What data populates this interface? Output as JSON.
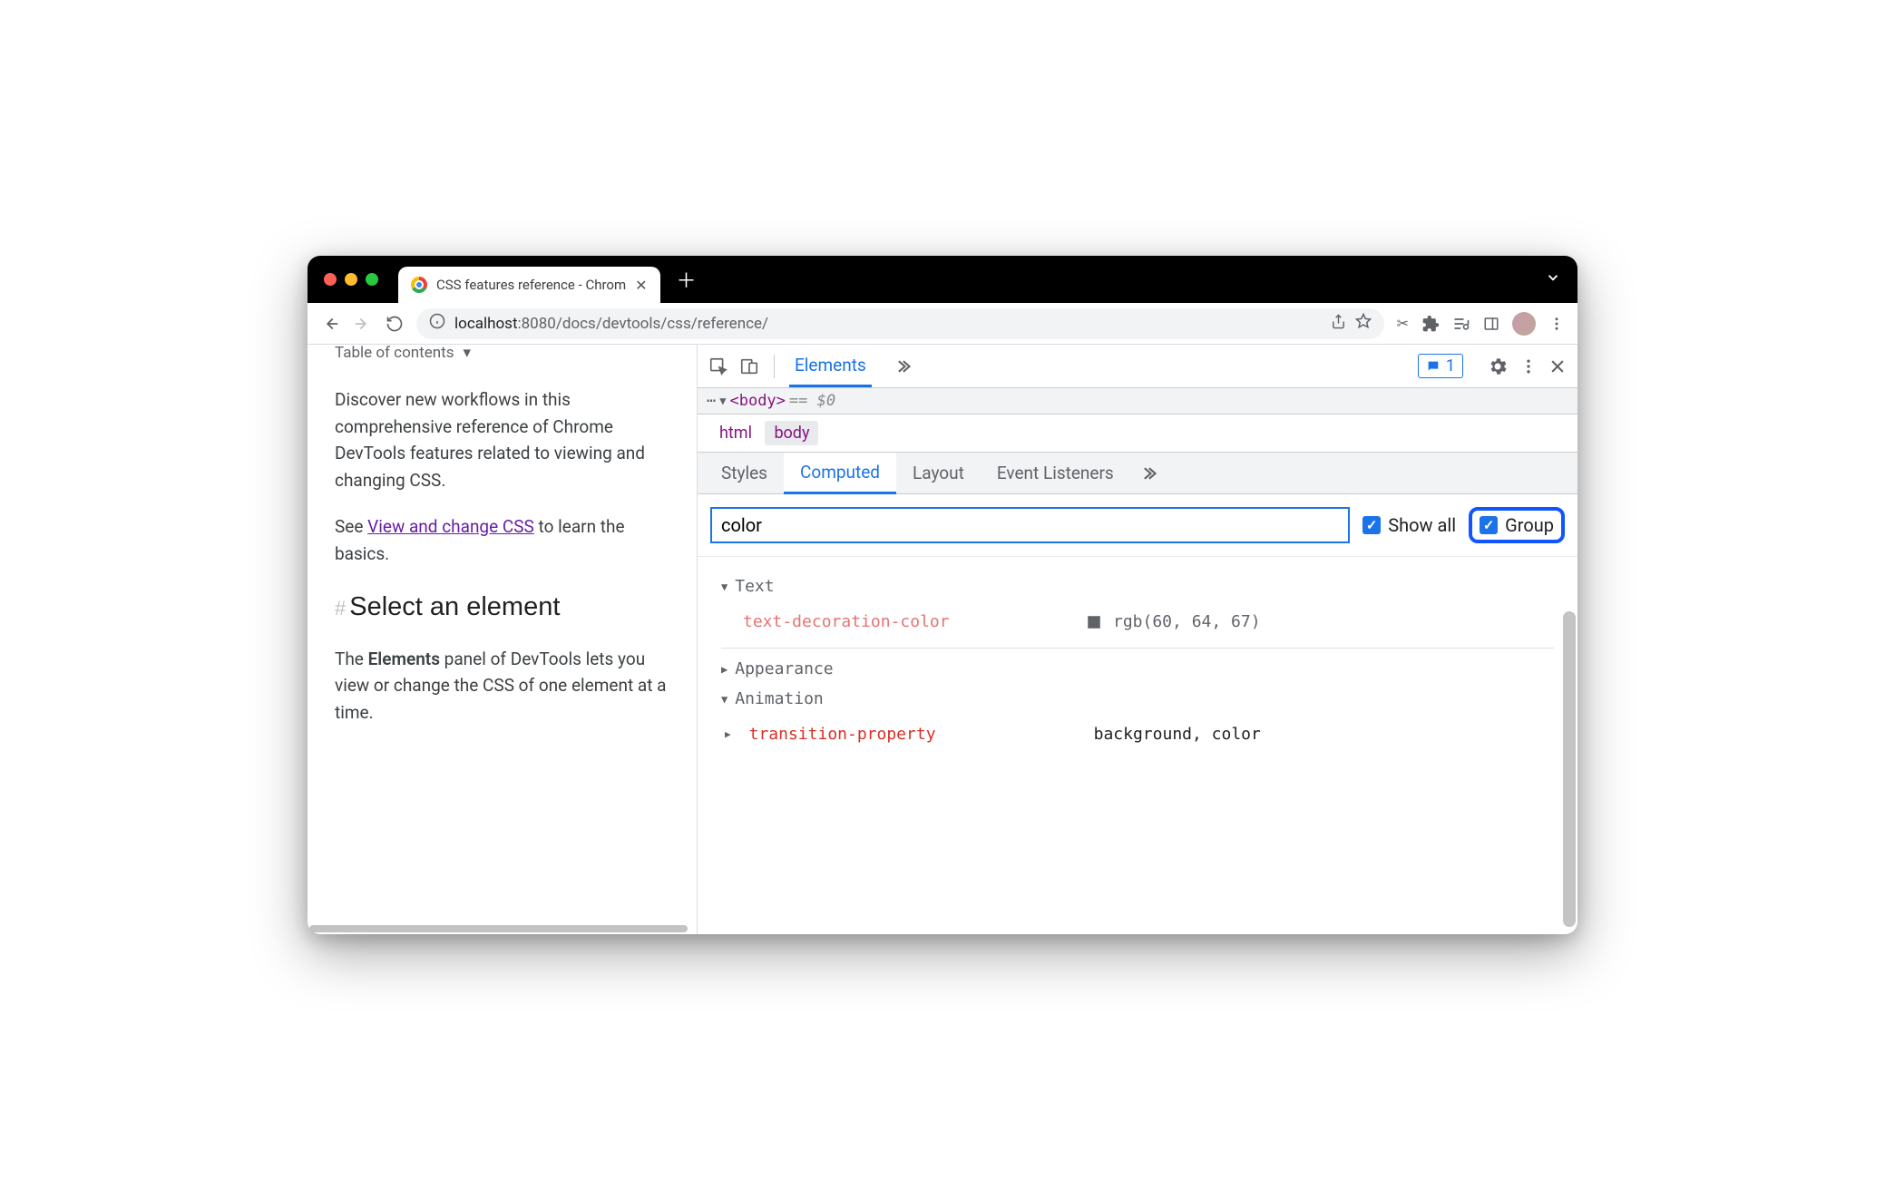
{
  "tabbar": {
    "tab_title": "CSS features reference - Chrom"
  },
  "urlbar": {
    "host": "localhost",
    "port": ":8080",
    "path": "/docs/devtools/css/reference/"
  },
  "page": {
    "toc_label": "Table of contents",
    "p1": "Discover new workflows in this comprehensive reference of Chrome DevTools features related to viewing and changing CSS.",
    "p2a": "See ",
    "p2link": "View and change CSS",
    "p2b": " to learn the basics.",
    "h2": "Select an element",
    "p3a": "The ",
    "p3b": "Elements",
    "p3c": " panel of DevTools lets you view or change the CSS of one element at a time."
  },
  "devtools": {
    "toolbar": {
      "tab_elements": "Elements",
      "msg_count": "1"
    },
    "elem": {
      "tag": "<body>",
      "eq": "== $0"
    },
    "crumbs": {
      "c1": "html",
      "c2": "body"
    },
    "subtabs": {
      "t1": "Styles",
      "t2": "Computed",
      "t3": "Layout",
      "t4": "Event Listeners"
    },
    "filter": {
      "value": "color",
      "show_all": "Show all",
      "group": "Group"
    },
    "groups": {
      "text": {
        "label": "Text",
        "prop": "text-decoration-color",
        "val": "rgb(60, 64, 67)"
      },
      "appearance": {
        "label": "Appearance"
      },
      "animation": {
        "label": "Animation",
        "prop": "transition-property",
        "val": "background, color"
      }
    }
  }
}
